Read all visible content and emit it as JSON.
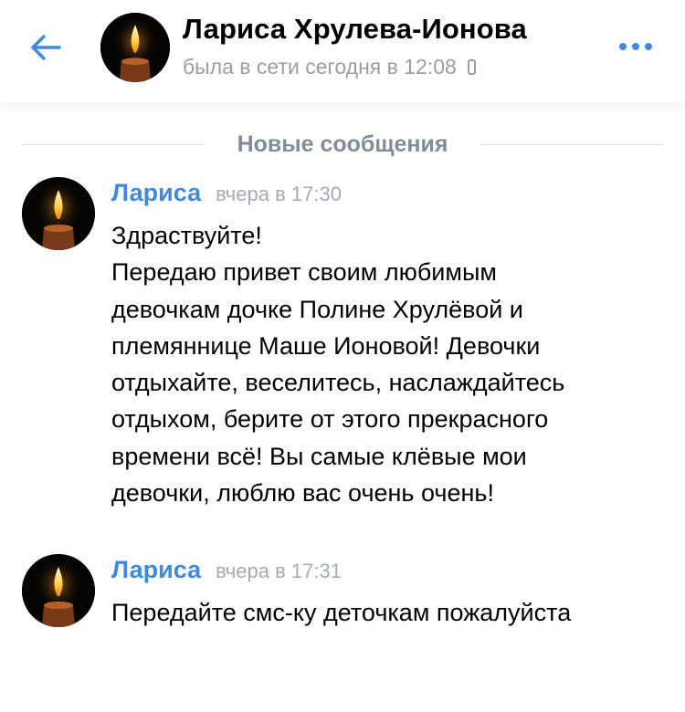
{
  "header": {
    "back_icon": "arrow-left-icon",
    "name": "Лариса Хрулева-Ионова",
    "status": "была в сети сегодня в 12:08",
    "device_icon": "mobile-phone-icon",
    "more_icon": "more-dots-icon",
    "avatar": "candle-avatar"
  },
  "divider": {
    "label": "Новые сообщения"
  },
  "messages": [
    {
      "author": "Лариса",
      "time": "вчера в 17:30",
      "lines": [
        "Здраствуйте!",
        "Передаю привет своим любимым",
        "девочкам дочке Полине Хрулёвой и",
        "племяннице Маше Ионовой! Девочки",
        "отдыхайте, веселитесь, наслаждайтесь",
        "отдыхом, берите от этого прекрасного",
        "времени всё! Вы самые клёвые мои",
        "девочки, люблю вас очень очень!"
      ]
    },
    {
      "author": "Лариса",
      "time": "вчера в 17:31",
      "lines": [
        "Передайте смс-ку деточкам пожалуйста"
      ]
    }
  ],
  "colors": {
    "accent": "#3f8ae0",
    "secondary_text": "#9a9ea4",
    "divider_text": "#818c99"
  }
}
